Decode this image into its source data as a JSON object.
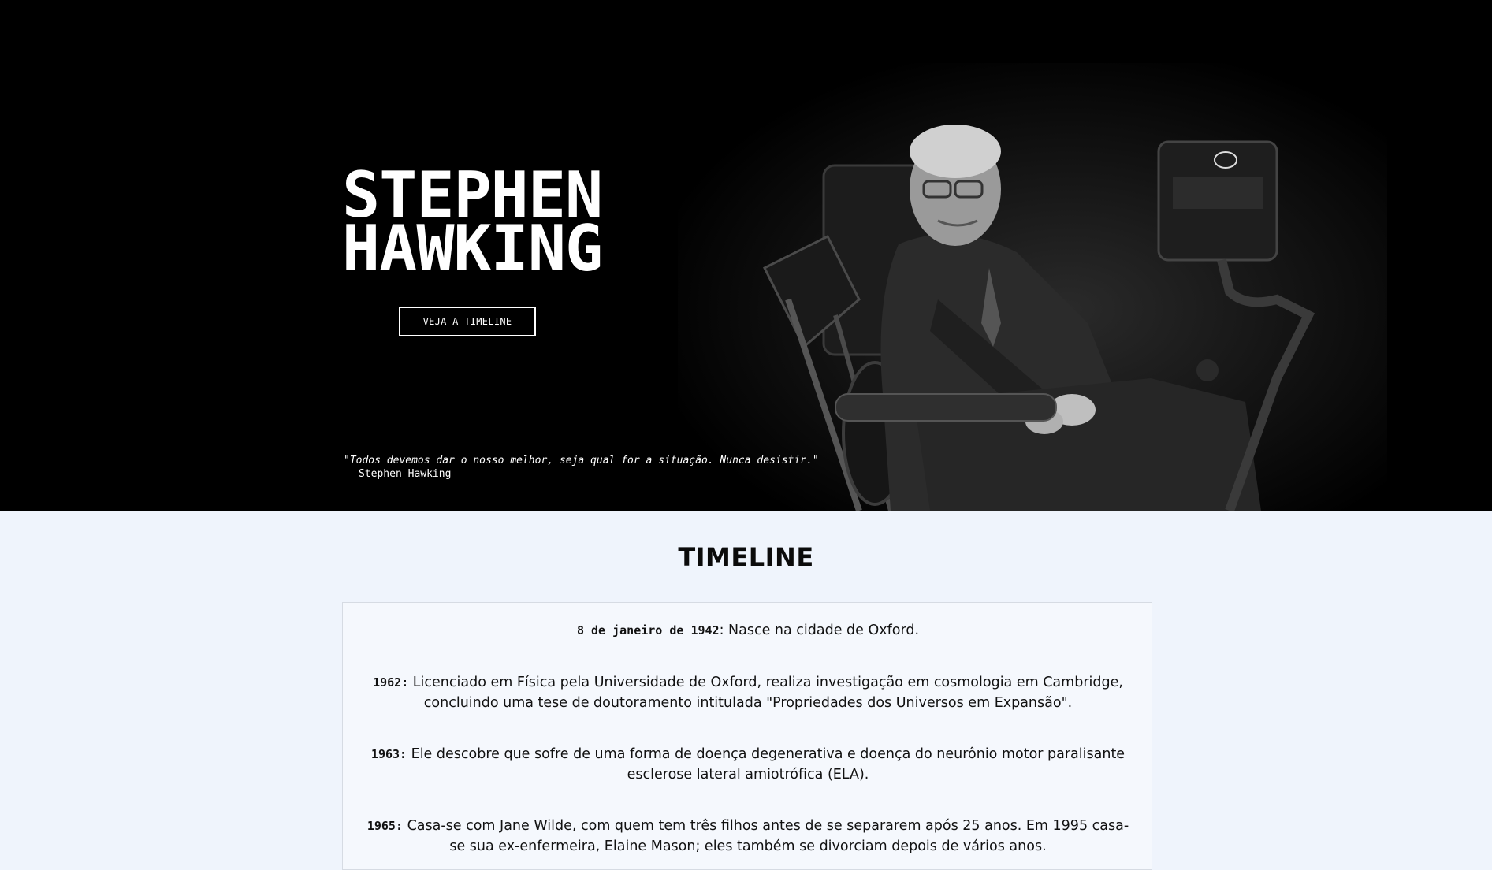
{
  "hero": {
    "title_line1": "STEPHEN",
    "title_line2": "HAWKING",
    "button_label": "VEJA A TIMELINE",
    "quote": "\"Todos devemos dar o nosso melhor, seja qual for a situação. Nunca desistir.\"",
    "quote_author": "Stephen Hawking",
    "background_color": "#000000"
  },
  "timeline": {
    "heading": "TIMELINE",
    "entries": [
      {
        "date": "8 de janeiro de 1942",
        "text": ": Nasce na cidade de Oxford."
      },
      {
        "date": "1962:",
        "text": " Licenciado em Física pela Universidade de Oxford, realiza investigação em cosmologia em Cambridge, concluindo uma tese de doutoramento intitulada \"Propriedades dos Universos em Expansão\"."
      },
      {
        "date": "1963:",
        "text": " Ele descobre que sofre de uma forma de doença degenerativa e doença do neurônio motor paralisante esclerose lateral amiotrófica (ELA)."
      },
      {
        "date": "1965:",
        "text": " Casa-se com Jane Wilde, com quem tem três filhos antes de se separarem após 25 anos. Em 1995 casa-se sua ex-enfermeira, Elaine Mason; eles também se divorciam depois de vários anos."
      }
    ]
  },
  "colors": {
    "page_background": "#eff4fc",
    "card_border": "#d6dbe3"
  }
}
